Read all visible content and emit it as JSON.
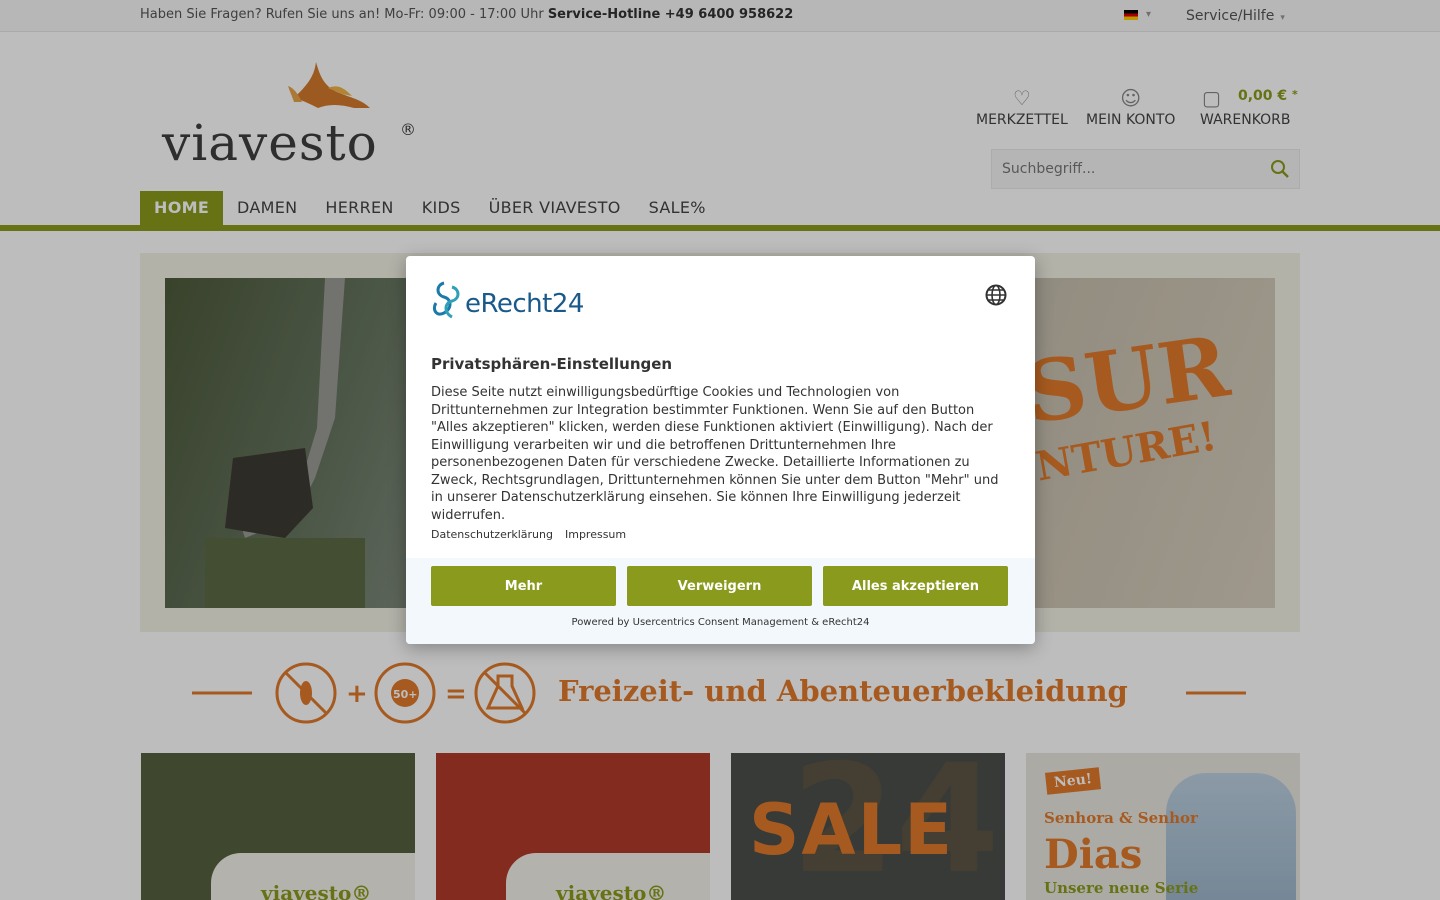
{
  "topbar": {
    "info_text": "Haben Sie Fragen? Rufen Sie uns an! Mo-Fr: 09:00 - 17:00 Uhr",
    "hotline": "Service-Hotline +49 6400 958622",
    "service_label": "Service/Hilfe"
  },
  "header": {
    "logo_text": "viavesto",
    "logo_reg": "®",
    "merkzettel": "MERKZETTEL",
    "mein_konto": "MEIN KONTO",
    "warenkorb": "WARENKORB",
    "cart_amount": "0,00 €",
    "cart_plus": "*",
    "search_placeholder": "Suchbegriff..."
  },
  "nav": {
    "items": [
      "HOME",
      "DAMEN",
      "HERREN",
      "KIDS",
      "ÜBER VIAVESTO",
      "SALE%"
    ],
    "active": "HOME"
  },
  "hero": {
    "text1": "SUR",
    "text2": "NTURE!"
  },
  "banner": {
    "title": "Freizeit- und Abenteuerbekleidung",
    "sun_label": "50+"
  },
  "tiles": {
    "tile1_logo": "viavesto®",
    "tile2_logo": "viavesto®",
    "tile3_text": "SALE",
    "tile3_bg": "24",
    "tile4_badge": "Neu!",
    "tile4_line1": "Senhora & Senhor",
    "tile4_line2": "Dias",
    "tile4_line3": "Unsere neue Serie"
  },
  "consent": {
    "brand": "eRecht24",
    "title": "Privatsphären-Einstellungen",
    "body": "Diese Seite nutzt einwilligungsbedürftige Cookies und Technologien von Drittunternehmen zur Integration bestimmter Funktionen. Wenn Sie auf den Button \"Alles akzeptieren\" klicken, werden diese Funktionen aktiviert (Einwilligung). Nach der Einwilligung verarbeiten wir und die betroffenen Drittunternehmen Ihre personenbezogenen Daten für verschiedene Zwecke. Detaillierte Informationen zu Zweck, Rechtsgrundlagen, Drittunternehmen können Sie unter dem Button \"Mehr\" und in unserer Datenschutzerklärung einsehen. Sie können Ihre Einwilligung jederzeit widerrufen.",
    "link_privacy": "Datenschutzerklärung",
    "link_imprint": "Impressum",
    "btn_more": "Mehr",
    "btn_deny": "Verweigern",
    "btn_accept": "Alles akzeptieren",
    "powered": "Powered by Usercentrics Consent Management & eRecht24"
  },
  "colors": {
    "accent_green": "#8a9a1c",
    "accent_orange": "#e07a2a",
    "brand_blue": "#1a5a8a"
  }
}
